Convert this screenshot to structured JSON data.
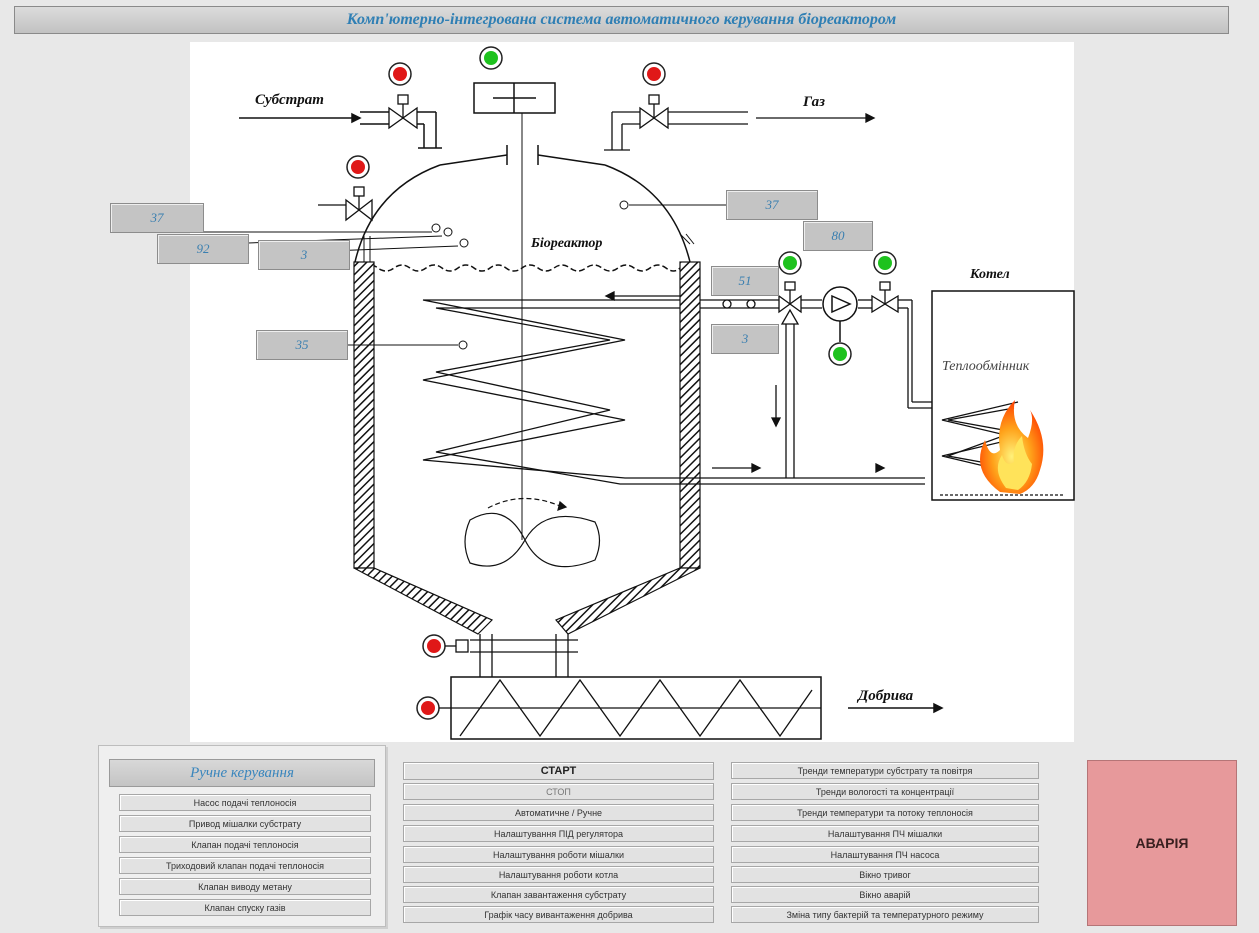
{
  "title": "Комп'ютерно-інтегрована система автоматичного керування біореактором",
  "scheme": {
    "labels": {
      "substrate": "Субстрат",
      "gas": "Газ",
      "bioreactor": "Біореактор",
      "boiler": "Котел",
      "heat_exchanger": "Теплообмінник",
      "fertilizer": "Добрива"
    },
    "values": {
      "gas_top": "37",
      "left_upper": "37",
      "left_mid": "92",
      "left_level": "3",
      "left_lower": "35",
      "pump_top": "80",
      "line_in": "51",
      "line_out": "3"
    }
  },
  "manual_panel": {
    "title": "Ручне керування",
    "buttons": [
      "Насос подачі теплоносія",
      "Привод мішалки субстрату",
      "Клапан подачі теплоносія",
      "Триходовий клапан подачі теплоносія",
      "Клапан виводу метану",
      "Клапан спуску газів"
    ]
  },
  "control_buttons": [
    "СТАРТ",
    "СТОП",
    "Автоматичне / Ручне",
    "Налаштування ПІД регулятора",
    "Налаштування роботи мішалки",
    "Налаштування роботи котла",
    "Клапан завантаження субстрату",
    "Графік часу вивантаження добрива"
  ],
  "trend_buttons": [
    "Тренди температури субстрату та повітря",
    "Тренди вологості та концентрації",
    "Тренди температури та потоку теплоносія",
    "Налаштування ПЧ мішалки",
    "Налаштування ПЧ насоса",
    "Вікно тривог",
    "Вікно аварій",
    "Зміна типу бактерій та температурного режиму"
  ],
  "alarm_label": "АВАРІЯ",
  "colors": {
    "title_text": "#2f7fb4",
    "value_text": "#3a7fb0",
    "indicator_red": "#e01818",
    "indicator_green": "#1ec21e",
    "alarm_bg": "#e7999b",
    "flame": "#ff8a00"
  }
}
